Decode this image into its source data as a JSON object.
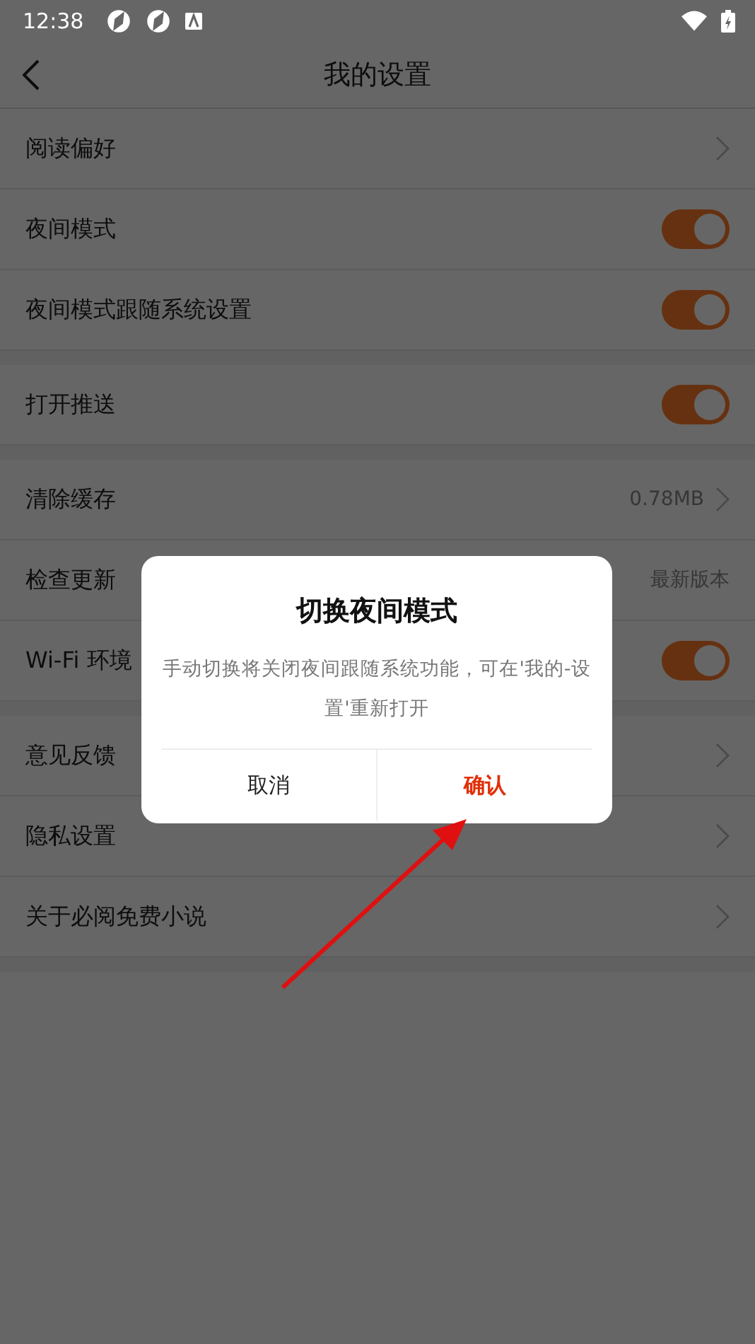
{
  "status_bar": {
    "time": "12:38"
  },
  "header": {
    "title": "我的设置"
  },
  "sections": [
    {
      "rows": [
        {
          "kind": "link",
          "label": "阅读偏好"
        },
        {
          "kind": "toggle",
          "label": "夜间模式",
          "on": true
        },
        {
          "kind": "toggle",
          "label": "夜间模式跟随系统设置",
          "on": true
        }
      ]
    },
    {
      "rows": [
        {
          "kind": "toggle",
          "label": "打开推送",
          "on": true
        }
      ]
    },
    {
      "rows": [
        {
          "kind": "link",
          "label": "清除缓存",
          "value": "0.78MB"
        },
        {
          "kind": "value",
          "label": "检查更新",
          "value": "最新版本"
        },
        {
          "kind": "toggle",
          "label": "Wi-Fi 环境",
          "on": true
        }
      ]
    },
    {
      "rows": [
        {
          "kind": "link",
          "label": "意见反馈"
        },
        {
          "kind": "link",
          "label": "隐私设置"
        },
        {
          "kind": "link",
          "label": "关于必阅免费小说"
        }
      ]
    }
  ],
  "dialog": {
    "title": "切换夜间模式",
    "message": "手动切换将关闭夜间跟随系统功能，可在'我的-设置'重新打开",
    "buttons": [
      {
        "label": "取消",
        "primary": false
      },
      {
        "label": "确认",
        "primary": true
      }
    ]
  }
}
